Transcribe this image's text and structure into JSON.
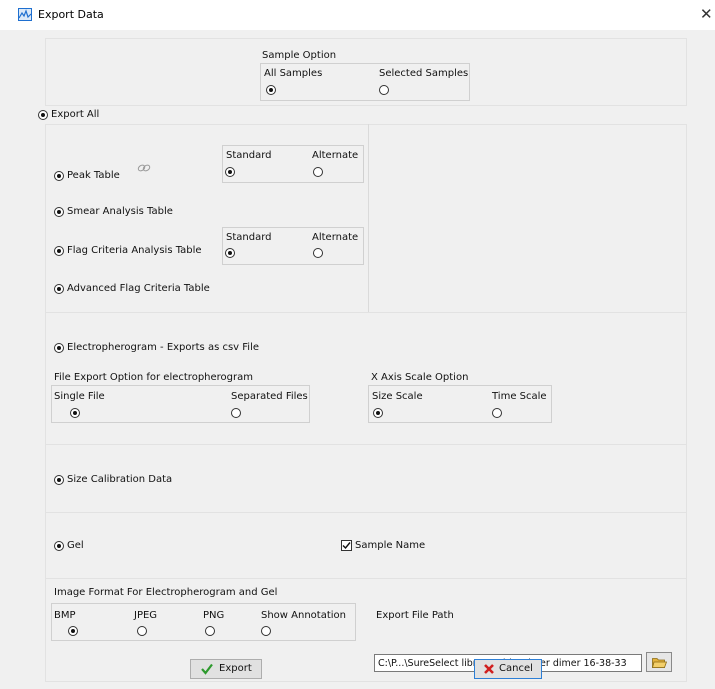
{
  "window": {
    "title": "Export Data",
    "close_glyph": "✕"
  },
  "sample_option": {
    "label": "Sample Option",
    "options": [
      {
        "label": "All Samples",
        "selected": true
      },
      {
        "label": "Selected Samples",
        "selected": false
      }
    ]
  },
  "export_all": {
    "label": "Export All",
    "selected": true
  },
  "tables": {
    "peak_table": {
      "label": "Peak Table",
      "selected": true,
      "icon": "link-icon"
    },
    "peak_format": {
      "standard": "Standard",
      "alternate": "Alternate",
      "selected": "Standard"
    },
    "smear_analysis": {
      "label": "Smear Analysis Table",
      "selected": true
    },
    "flag_criteria": {
      "label": "Flag Criteria Analysis Table",
      "selected": true
    },
    "flag_format": {
      "standard": "Standard",
      "alternate": "Alternate",
      "selected": "Standard"
    },
    "advanced_flag": {
      "label": "Advanced Flag Criteria Table",
      "selected": true
    }
  },
  "electropherogram": {
    "label": "Electropherogram - Exports as csv File",
    "selected": true,
    "file_option": {
      "label": "File Export Option for electropherogram",
      "single": "Single File",
      "separated": "Separated Files",
      "selected": "Single File"
    },
    "x_axis": {
      "label": "X Axis Scale Option",
      "size": "Size Scale",
      "time": "Time Scale",
      "selected": "Size Scale"
    }
  },
  "size_calibration": {
    "label": "Size Calibration Data",
    "selected": true
  },
  "gel": {
    "label": "Gel",
    "selected": true,
    "sample_name": "Sample Name",
    "sample_name_checked": true
  },
  "image_format": {
    "label": "Image Format For Electropherogram and Gel",
    "options": [
      {
        "label": "BMP",
        "selected": true
      },
      {
        "label": "JPEG",
        "selected": false
      },
      {
        "label": "PNG",
        "selected": false
      },
      {
        "label": "Show Annotation",
        "selected": false
      }
    ]
  },
  "export_path": {
    "label": "Export File Path",
    "value": "C:\\P...\\SureSelect library with primer dimer 16-38-33"
  },
  "buttons": {
    "export": "Export",
    "cancel": "Cancel"
  },
  "colors": {
    "accent": "#1e6fd0",
    "check": "#2e9a2e",
    "cancel_x": "#d02020",
    "folder": "#e3b23c"
  }
}
